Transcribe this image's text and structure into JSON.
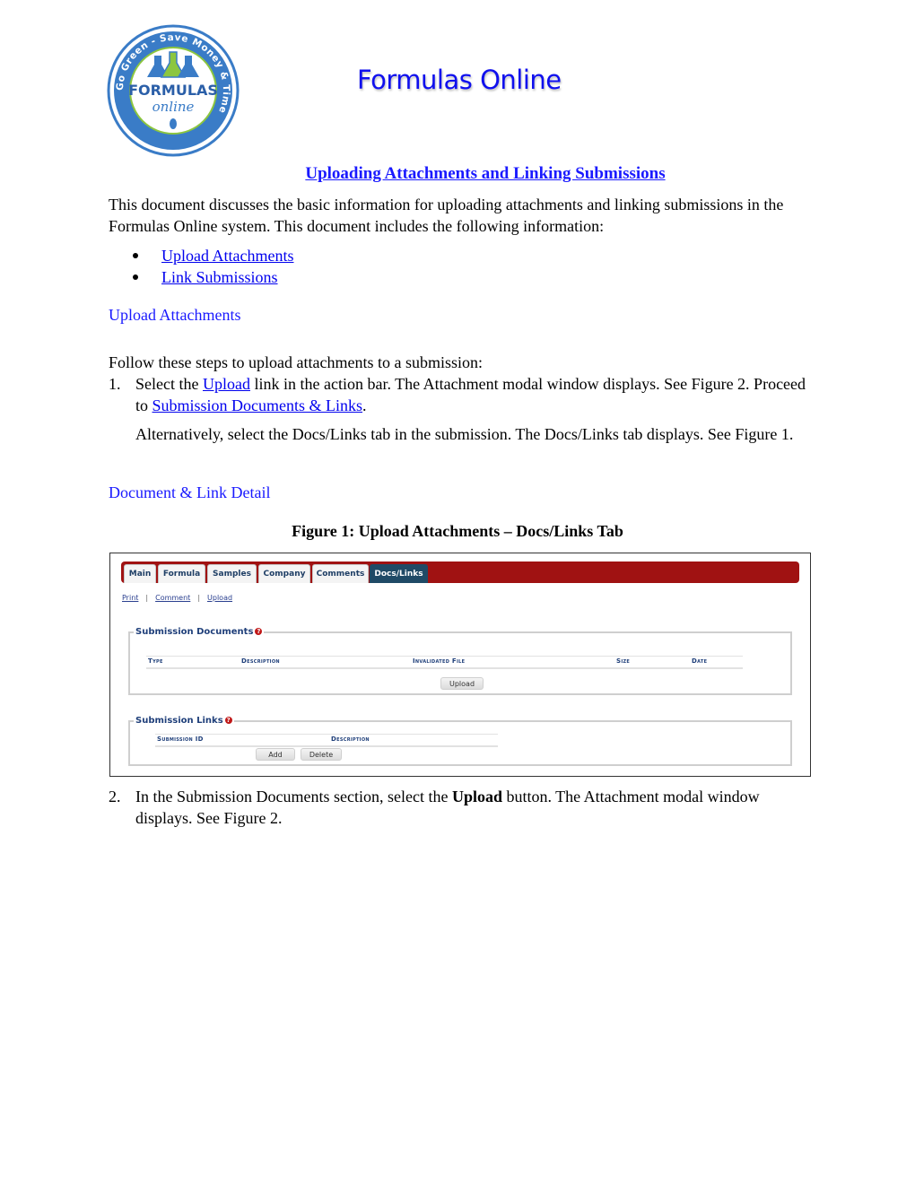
{
  "logo": {
    "ring_text": "Go Green - Save Money & Time",
    "center_title": "FORMULAS",
    "center_sub": "online",
    "colors": {
      "ring": "#3a7cc7",
      "accent": "#8cc63f",
      "title": "#2b5fa8"
    }
  },
  "header": {
    "title": "Formulas Online"
  },
  "document": {
    "title": "Uploading Attachments and Linking Submissions",
    "intro": "This document discusses the basic information for uploading attachments and linking submissions in the Formulas Online system. This document includes the following information:",
    "toc": [
      {
        "label": "Upload Attachments"
      },
      {
        "label": "Link Submissions"
      }
    ],
    "section_upload": {
      "heading": "Upload Attachments",
      "lead": "Follow these steps to upload attachments to a submission:",
      "step1": {
        "number": "1.",
        "pre": "Select the ",
        "link1": "Upload",
        "mid": " link in the action bar.  The Attachment modal window displays.  See Figure 2.  Proceed to ",
        "link2": "Submission Documents & Links",
        "post": ".",
        "alt": "Alternatively, select the Docs/Links tab in the submission.  The Docs/Links tab displays.  See Figure 1."
      }
    },
    "section_detail": {
      "heading": "Document & Link Detail"
    },
    "figure_caption": "Figure 1: Upload Attachments – Docs/Links Tab",
    "step2": {
      "number": "2.",
      "pre": "In the Submission Documents section, select the ",
      "bold": "Upload",
      "post": " button.  The Attachment modal window displays.  See Figure 2."
    }
  },
  "figure": {
    "tabs": [
      {
        "label": "Main",
        "active": false
      },
      {
        "label": "Formula",
        "active": false
      },
      {
        "label": "Samples",
        "active": false
      },
      {
        "label": "Company",
        "active": false
      },
      {
        "label": "Comments",
        "active": false
      },
      {
        "label": "Docs/Links",
        "active": true
      }
    ],
    "actions": [
      "Print",
      "Comment",
      "Upload"
    ],
    "action_separator": "|",
    "documents": {
      "legend": "Submission Documents",
      "help_icon": "?",
      "columns": [
        "Type",
        "Description",
        "Invalidated File",
        "Size",
        "Date"
      ],
      "upload_button": "Upload"
    },
    "links": {
      "legend": "Submission Links",
      "help_icon": "?",
      "columns": [
        "Submission ID",
        "Description"
      ],
      "add_button": "Add",
      "delete_button": "Delete"
    },
    "colors": {
      "tabbar": "#a01212",
      "active_tab": "#1f4a66",
      "legend": "#1f3f7a"
    }
  }
}
